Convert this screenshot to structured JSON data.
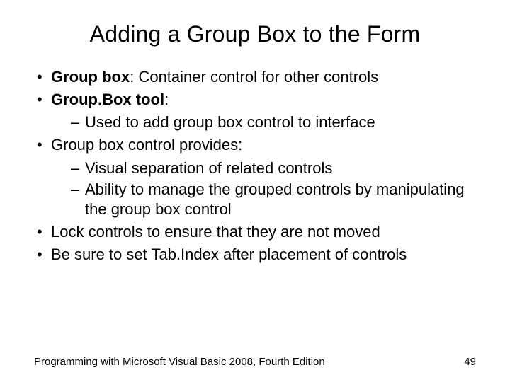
{
  "title": "Adding a Group Box to the Form",
  "bullets": {
    "b1": {
      "bold": "Group box",
      "rest": ": Container control for other controls"
    },
    "b2": {
      "bold": "Group.Box tool",
      "rest": ":"
    },
    "b2_sub1": "Used to add group box control to interface",
    "b3": "Group box control provides:",
    "b3_sub1": "Visual separation of related controls",
    "b3_sub2": "Ability to manage the grouped controls by manipulating the group box control",
    "b4": "Lock controls to ensure that they are not moved",
    "b5": "Be sure to set Tab.Index after placement of controls"
  },
  "footer": {
    "left": "Programming with Microsoft Visual Basic 2008, Fourth Edition",
    "right": "49"
  }
}
